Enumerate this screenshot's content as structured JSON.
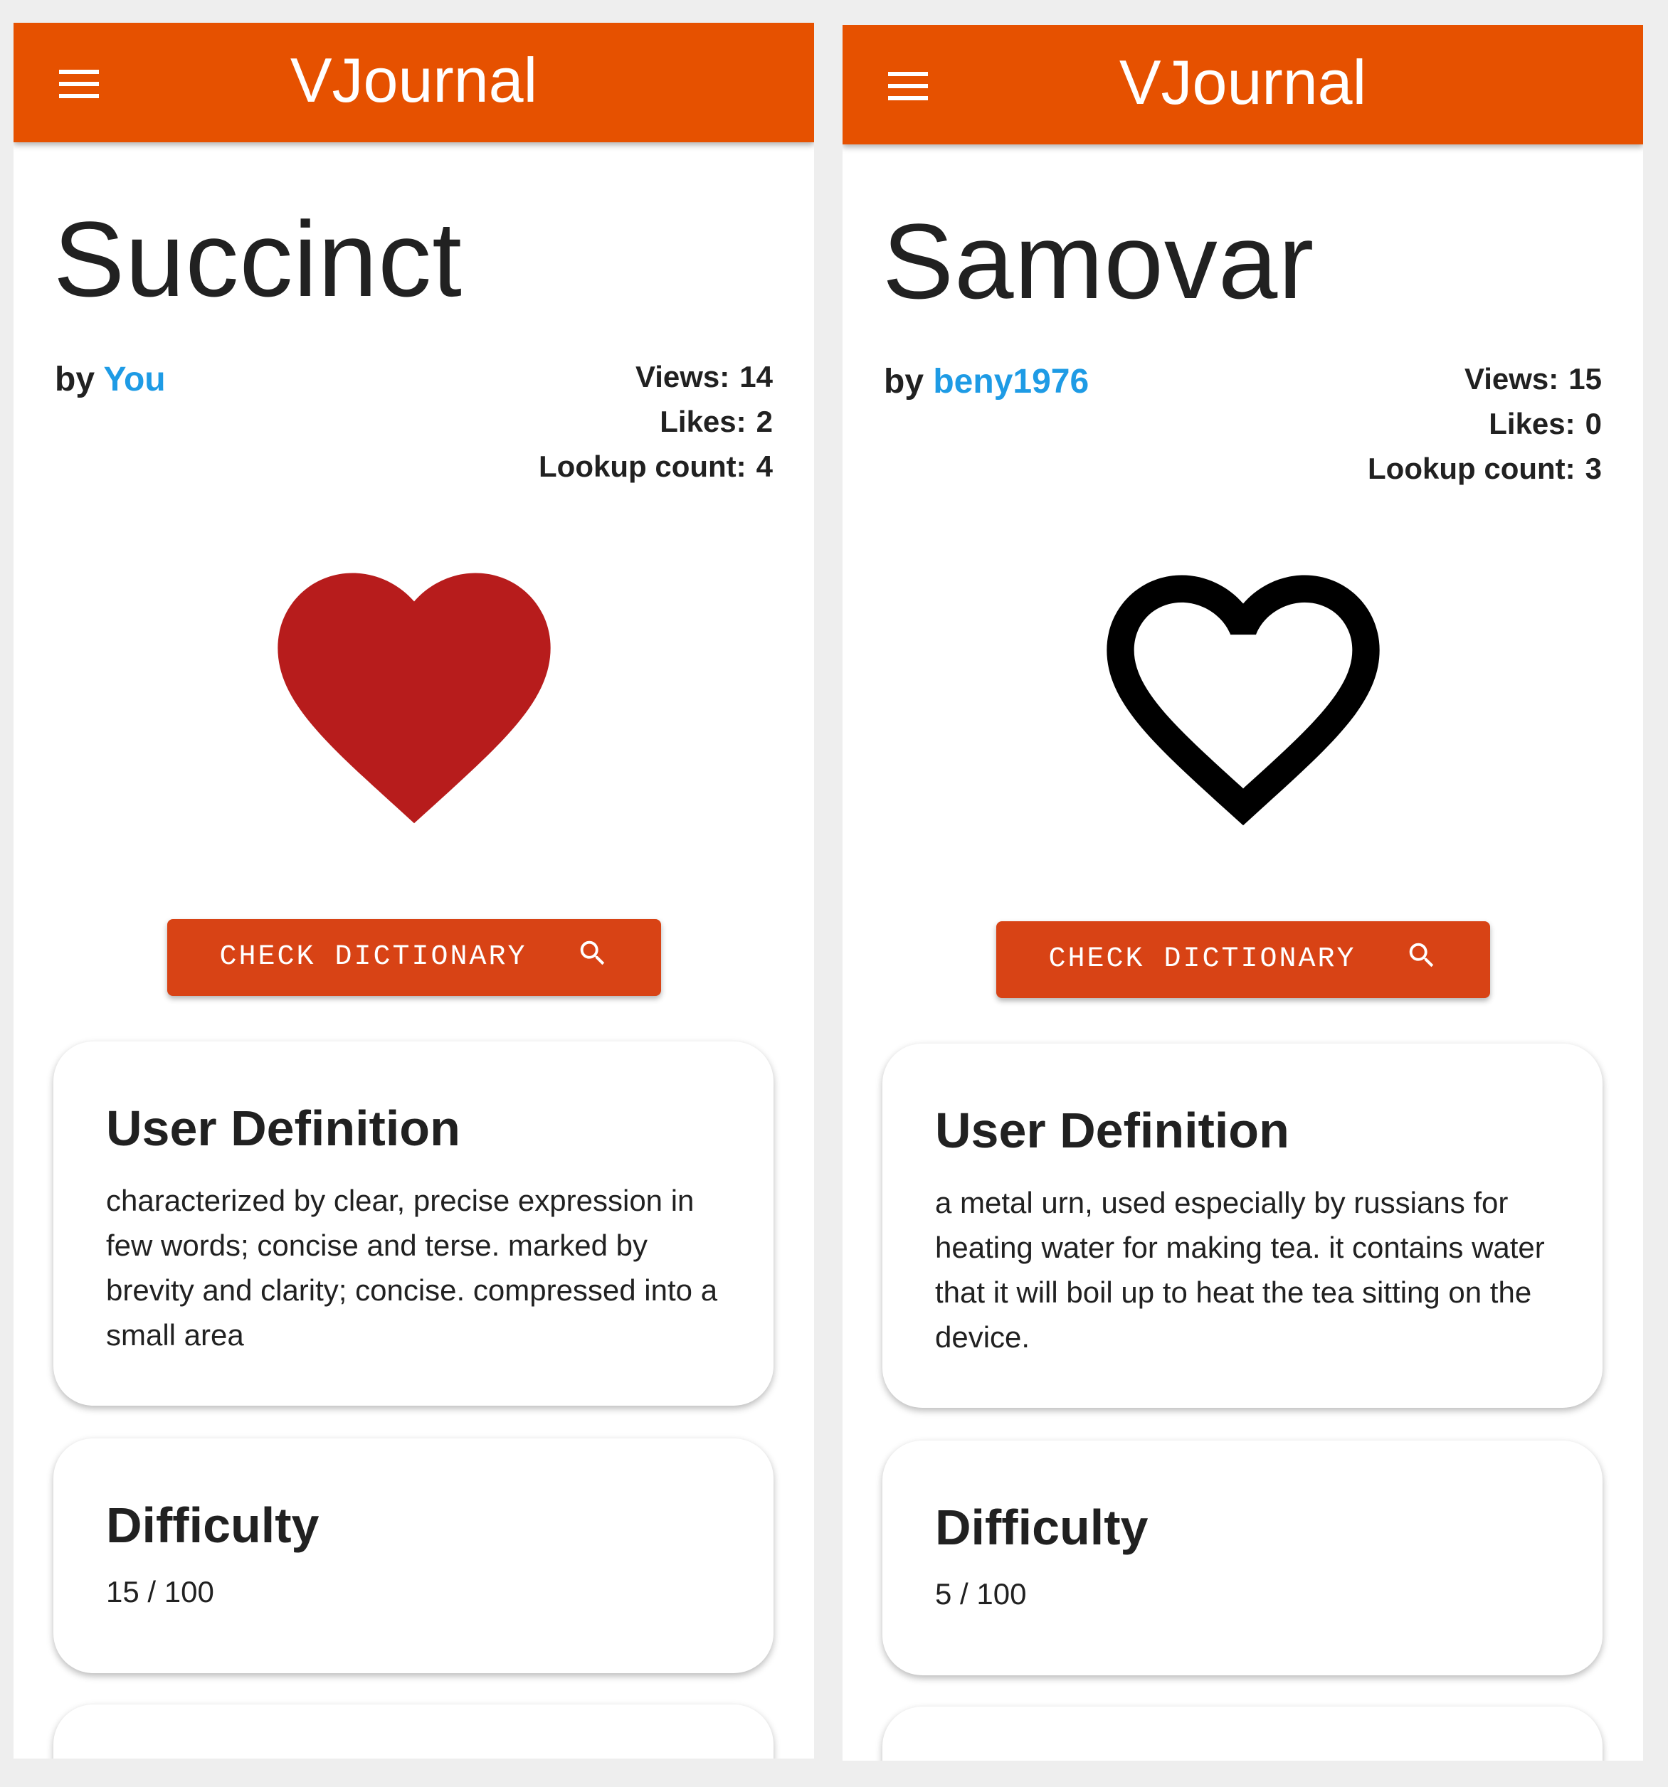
{
  "screens": [
    {
      "app_title": "VJournal",
      "word": "Succinct",
      "by_label": "by",
      "author": "You",
      "stats": {
        "views_label": "Views:",
        "views": "14",
        "likes_label": "Likes:",
        "likes": "2",
        "lookup_label": "Lookup count:",
        "lookup": "4"
      },
      "liked": true,
      "heart_color": "#b71c1c",
      "dict_button": "CHECK DICTIONARY",
      "definition_title": "User Definition",
      "definition": "characterized by clear, precise expression in few words; concise and terse. marked by brevity and clarity; concise. compressed into a small area",
      "difficulty_title": "Difficulty",
      "difficulty": "15 / 100"
    },
    {
      "app_title": "VJournal",
      "word": "Samovar",
      "by_label": "by",
      "author": "beny1976",
      "stats": {
        "views_label": "Views:",
        "views": "15",
        "likes_label": "Likes:",
        "likes": "0",
        "lookup_label": "Lookup count:",
        "lookup": "3"
      },
      "liked": false,
      "heart_color": "#000000",
      "dict_button": "CHECK DICTIONARY",
      "definition_title": "User Definition",
      "definition": "a metal urn, used especially by russians for heating water for making tea. it contains water that it will boil up to heat the tea sitting on the device.",
      "difficulty_title": "Difficulty",
      "difficulty": "5 / 100"
    }
  ],
  "colors": {
    "appbar": "#e65100",
    "button": "#d84315",
    "author_link": "#1e9be5",
    "background": "#eeeeee"
  },
  "icons": {
    "menu": "menu-icon",
    "heart_filled": "heart-filled-icon",
    "heart_outline": "heart-outline-icon",
    "search": "search-icon"
  }
}
